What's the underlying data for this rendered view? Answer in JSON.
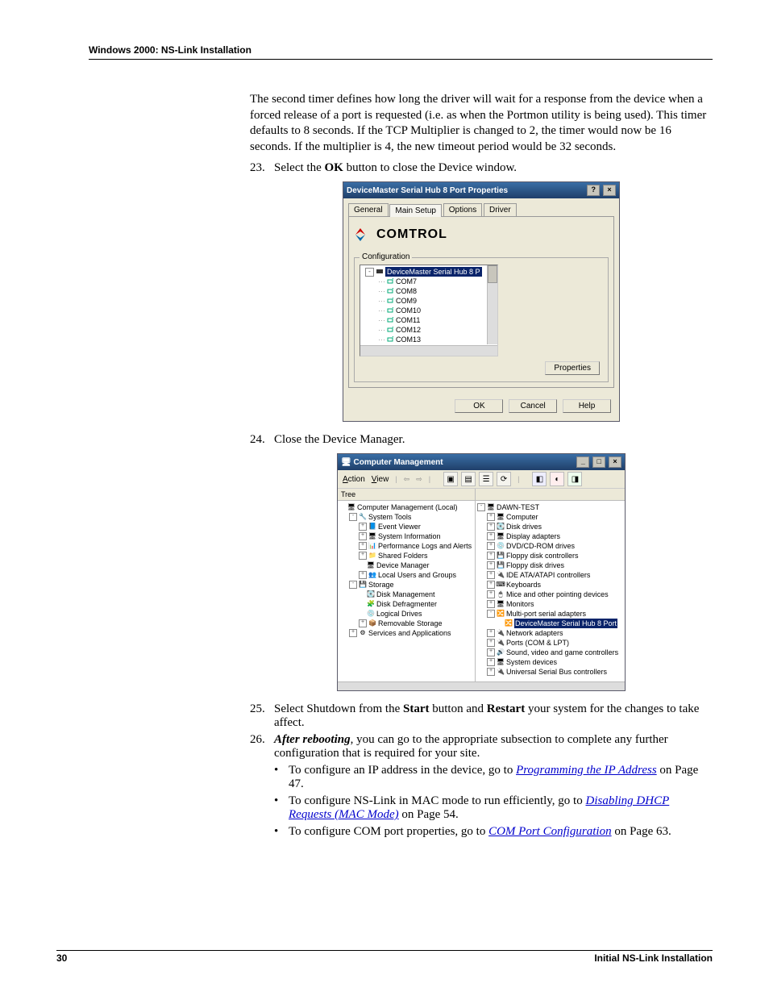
{
  "header": "Windows 2000: NS-Link Installation",
  "intro": "The second timer defines how long the driver will wait for a response from the device when a forced release of a port is requested (i.e. as when the Portmon utility is being used). This timer defaults to 8 seconds. If the TCP Multiplier is changed to 2, the timer would now be 16 seconds. If the multiplier is 4, the new timeout period would be 32 seconds.",
  "step23_num": "23.",
  "step23_a": "Select the ",
  "step23_b": "OK",
  "step23_c": " button to close the Device window.",
  "dialog": {
    "title": "DeviceMaster Serial Hub 8 Port Properties",
    "tb_help": "?",
    "tb_close": "×",
    "tabs": [
      "General",
      "Main Setup",
      "Options",
      "Driver"
    ],
    "logo": "COMTROL",
    "group": "Configuration",
    "tree_root": "DeviceMaster Serial Hub 8 P",
    "ports": [
      "COM7",
      "COM8",
      "COM9",
      "COM10",
      "COM11",
      "COM12",
      "COM13"
    ],
    "properties_btn": "Properties",
    "ok": "OK",
    "cancel": "Cancel",
    "help": "Help"
  },
  "step24_num": "24.",
  "step24": "Close the Device Manager.",
  "cm": {
    "title": "Computer Management",
    "tb_min": "_",
    "tb_max": "□",
    "tb_close": "×",
    "menu_action": "Action",
    "menu_view": "View",
    "left_head": "Tree",
    "left_items": [
      {
        "ind": 0,
        "tw": "",
        "ic": "🖥",
        "t": "Computer Management (Local)"
      },
      {
        "ind": 1,
        "tw": "-",
        "ic": "🔧",
        "t": "System Tools"
      },
      {
        "ind": 2,
        "tw": "+",
        "ic": "📘",
        "t": "Event Viewer"
      },
      {
        "ind": 2,
        "tw": "+",
        "ic": "🖥",
        "t": "System Information"
      },
      {
        "ind": 2,
        "tw": "+",
        "ic": "📊",
        "t": "Performance Logs and Alerts"
      },
      {
        "ind": 2,
        "tw": "+",
        "ic": "📁",
        "t": "Shared Folders"
      },
      {
        "ind": 2,
        "tw": "",
        "ic": "🖥",
        "t": "Device Manager"
      },
      {
        "ind": 2,
        "tw": "+",
        "ic": "👥",
        "t": "Local Users and Groups"
      },
      {
        "ind": 1,
        "tw": "-",
        "ic": "💾",
        "t": "Storage"
      },
      {
        "ind": 2,
        "tw": "",
        "ic": "💽",
        "t": "Disk Management"
      },
      {
        "ind": 2,
        "tw": "",
        "ic": "🧩",
        "t": "Disk Defragmenter"
      },
      {
        "ind": 2,
        "tw": "",
        "ic": "💿",
        "t": "Logical Drives"
      },
      {
        "ind": 2,
        "tw": "+",
        "ic": "📦",
        "t": "Removable Storage"
      },
      {
        "ind": 1,
        "tw": "+",
        "ic": "⚙",
        "t": "Services and Applications"
      }
    ],
    "right_items": [
      {
        "ind": 0,
        "tw": "-",
        "ic": "🖥",
        "t": "DAWN-TEST"
      },
      {
        "ind": 1,
        "tw": "+",
        "ic": "🖥",
        "t": "Computer"
      },
      {
        "ind": 1,
        "tw": "+",
        "ic": "💽",
        "t": "Disk drives"
      },
      {
        "ind": 1,
        "tw": "+",
        "ic": "🖥",
        "t": "Display adapters"
      },
      {
        "ind": 1,
        "tw": "+",
        "ic": "💿",
        "t": "DVD/CD-ROM drives"
      },
      {
        "ind": 1,
        "tw": "+",
        "ic": "💾",
        "t": "Floppy disk controllers"
      },
      {
        "ind": 1,
        "tw": "+",
        "ic": "💾",
        "t": "Floppy disk drives"
      },
      {
        "ind": 1,
        "tw": "+",
        "ic": "🔌",
        "t": "IDE ATA/ATAPI controllers"
      },
      {
        "ind": 1,
        "tw": "+",
        "ic": "⌨",
        "t": "Keyboards"
      },
      {
        "ind": 1,
        "tw": "+",
        "ic": "🖱",
        "t": "Mice and other pointing devices"
      },
      {
        "ind": 1,
        "tw": "+",
        "ic": "🖥",
        "t": "Monitors"
      },
      {
        "ind": 1,
        "tw": "-",
        "ic": "🔀",
        "t": "Multi-port serial adapters"
      },
      {
        "ind": 2,
        "tw": "",
        "ic": "🔀",
        "t": "DeviceMaster Serial Hub 8 Port",
        "sel": true
      },
      {
        "ind": 1,
        "tw": "+",
        "ic": "🔌",
        "t": "Network adapters"
      },
      {
        "ind": 1,
        "tw": "+",
        "ic": "🔌",
        "t": "Ports (COM & LPT)"
      },
      {
        "ind": 1,
        "tw": "+",
        "ic": "🔊",
        "t": "Sound, video and game controllers"
      },
      {
        "ind": 1,
        "tw": "+",
        "ic": "🖥",
        "t": "System devices"
      },
      {
        "ind": 1,
        "tw": "+",
        "ic": "🔌",
        "t": "Universal Serial Bus controllers"
      }
    ]
  },
  "step25_num": "25.",
  "step25_a": "Select Shutdown from the ",
  "step25_b": "Start",
  "step25_c": " button and ",
  "step25_d": "Restart",
  "step25_e": " your system for the changes to take affect.",
  "step26_num": "26.",
  "step26_a": "After rebooting",
  "step26_b": ", you can go to the appropriate subsection to complete any further configuration that is required for your site.",
  "bullets": [
    {
      "pre": "To configure an IP address in the device, go to ",
      "link": "Programming the IP Address",
      "post": " on Page 47."
    },
    {
      "pre": "To configure NS-Link in MAC mode to run efficiently, go to ",
      "link": "Disabling DHCP Requests (MAC Mode)",
      "post": " on Page 54."
    },
    {
      "pre": "To configure COM port properties, go to ",
      "link": "COM Port Configuration",
      "post": " on Page 63."
    }
  ],
  "footer_page": "30",
  "footer_right": "Initial NS-Link Installation"
}
